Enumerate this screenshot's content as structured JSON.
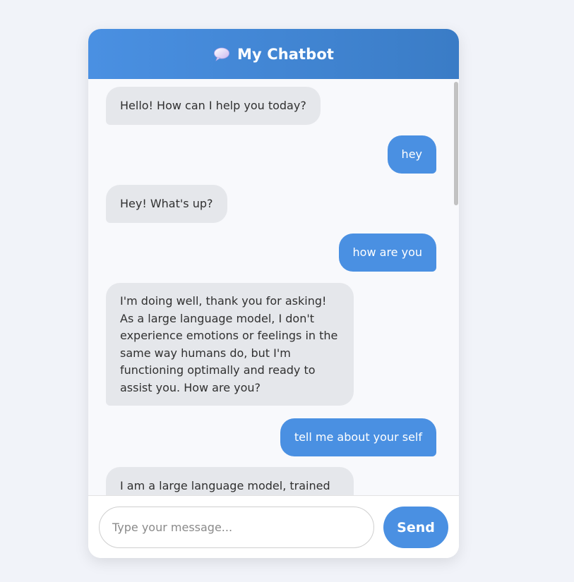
{
  "header": {
    "icon": "speech-bubble-icon",
    "title": "My Chatbot"
  },
  "messages": [
    {
      "sender": "bot",
      "text": "Hello! How can I help you today?"
    },
    {
      "sender": "user",
      "text": "hey"
    },
    {
      "sender": "bot",
      "text": "Hey! What's up?"
    },
    {
      "sender": "user",
      "text": "how are you"
    },
    {
      "sender": "bot",
      "text": "I'm doing well, thank you for asking! As a large language model, I don't experience emotions or feelings in the same way humans do, but I'm functioning optimally and ready to assist you. How are you?"
    },
    {
      "sender": "user",
      "text": "tell me about your self"
    },
    {
      "sender": "bot",
      "text": "I am a large language model, trained by"
    }
  ],
  "composer": {
    "placeholder": "Type your message...",
    "value": "",
    "send_label": "Send"
  },
  "colors": {
    "accent": "#4a90e2",
    "bot_bubble": "#e5e7eb",
    "page_bg": "#f1f3f9"
  }
}
